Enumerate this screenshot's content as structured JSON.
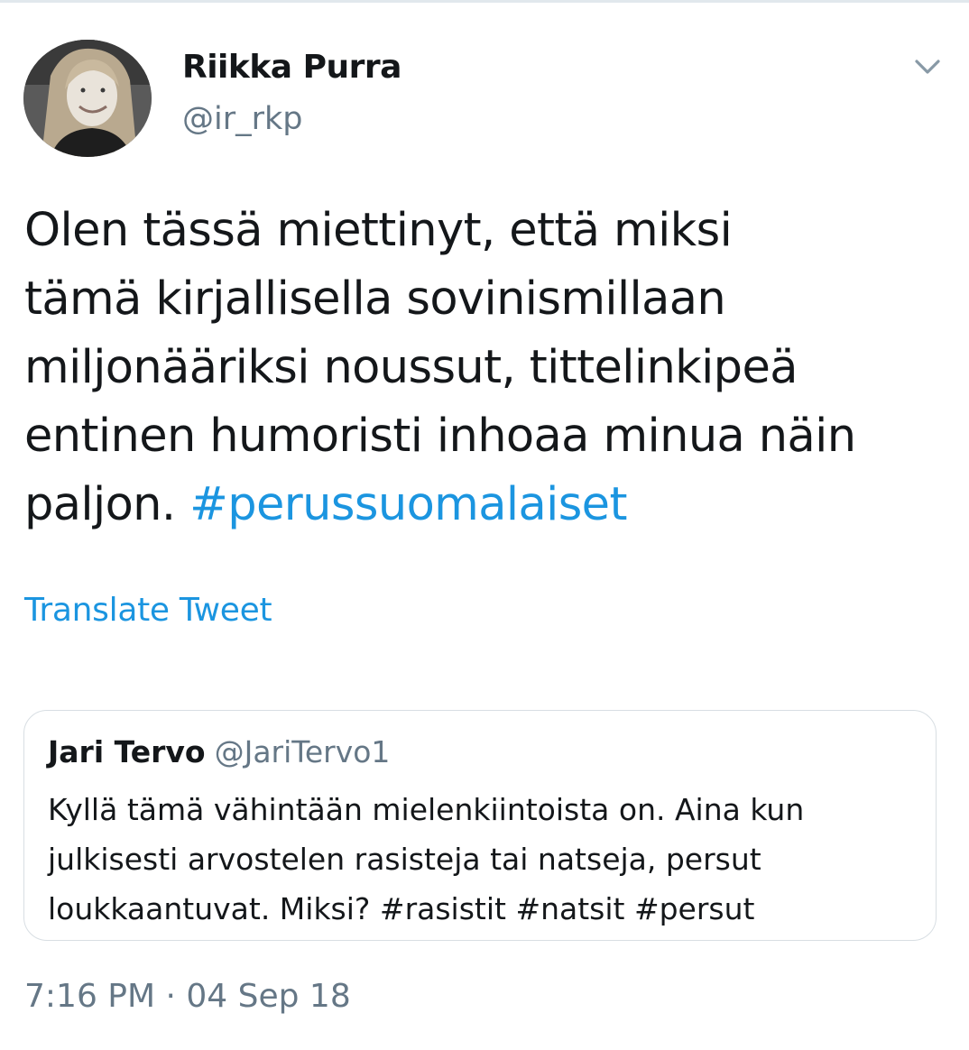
{
  "tweet": {
    "author": {
      "name": "Riikka Purra",
      "handle": "@ir_rkp",
      "avatar_icon": "profile-photo"
    },
    "menu_icon": "chevron-down-icon",
    "text_lines": [
      "Olen tässä miettinyt, että miksi",
      "tämä kirjallisella sovinismillaan",
      "miljonääriksi noussut, tittelinkipeä",
      "entinen humoristi inhoaa minua näin"
    ],
    "text_last_prefix": "paljon. ",
    "hashtag": "#perussuomalaiset",
    "translate_label": "Translate Tweet",
    "timestamp": "7:16 PM · 04 Sep 18"
  },
  "quoted": {
    "name": "Jari Tervo",
    "handle": "@JariTervo1",
    "lines": [
      "Kyllä tämä vähintään mielenkiintoista on. Aina kun",
      "julkisesti arvostelen rasisteja tai natseja, persut",
      "loukkaantuvat. Miksi? #rasistit #natsit #persut"
    ]
  },
  "colors": {
    "link": "#1b95e0",
    "secondary_text": "#657786",
    "primary_text": "#14171a",
    "border": "#d8dee3"
  }
}
